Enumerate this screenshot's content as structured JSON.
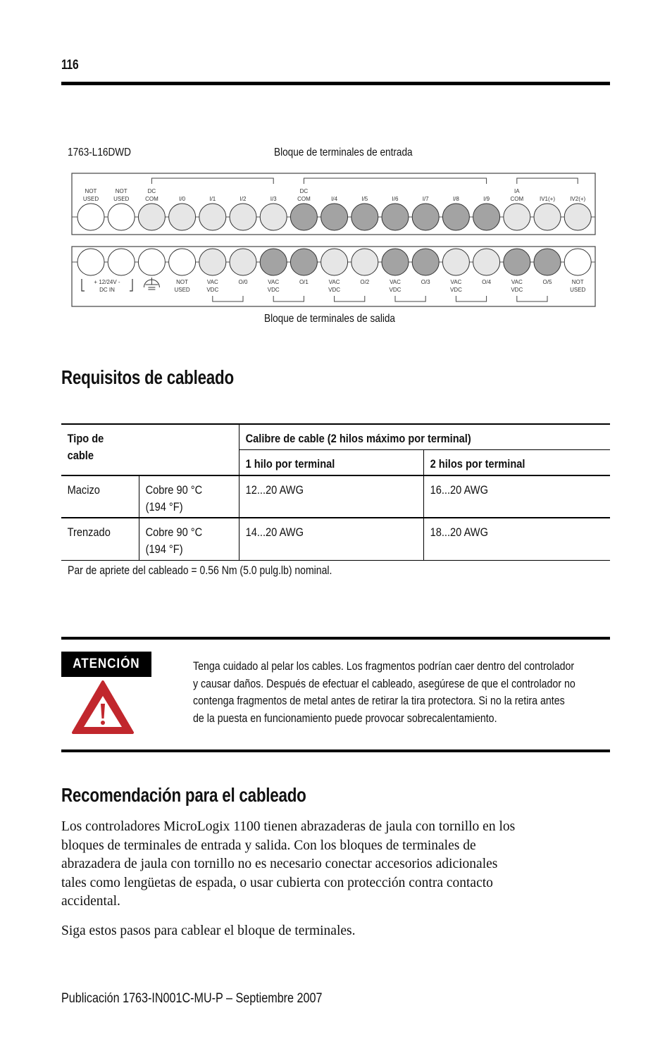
{
  "header": {
    "page_number": "116"
  },
  "diagram": {
    "model": "1763-L16DWD",
    "input_block_title": "Bloque de terminales de entrada",
    "output_block_title": "Bloque de terminales de salida",
    "input_terminals": [
      {
        "label": [
          "NOT",
          "USED"
        ],
        "shade": "white"
      },
      {
        "label": [
          "NOT",
          "USED"
        ],
        "shade": "white"
      },
      {
        "label": [
          "DC",
          "COM"
        ],
        "shade": "light"
      },
      {
        "label": [
          "I/0"
        ],
        "shade": "light"
      },
      {
        "label": [
          "I/1"
        ],
        "shade": "light"
      },
      {
        "label": [
          "I/2"
        ],
        "shade": "light"
      },
      {
        "label": [
          "I/3"
        ],
        "shade": "light"
      },
      {
        "label": [
          "DC",
          "COM"
        ],
        "shade": "dark"
      },
      {
        "label": [
          "I/4"
        ],
        "shade": "dark"
      },
      {
        "label": [
          "I/5"
        ],
        "shade": "dark"
      },
      {
        "label": [
          "I/6"
        ],
        "shade": "dark"
      },
      {
        "label": [
          "I/7"
        ],
        "shade": "dark"
      },
      {
        "label": [
          "I/8"
        ],
        "shade": "dark"
      },
      {
        "label": [
          "I/9"
        ],
        "shade": "dark"
      },
      {
        "label": [
          "IA",
          "COM"
        ],
        "shade": "light"
      },
      {
        "label": [
          "IV1(+)"
        ],
        "shade": "light"
      },
      {
        "label": [
          "IV2(+)"
        ],
        "shade": "light"
      }
    ],
    "output_terminals": [
      {
        "label": [],
        "shade": "white"
      },
      {
        "label": [],
        "shade": "white"
      },
      {
        "label": [],
        "shade": "white"
      },
      {
        "label": [
          "NOT",
          "USED"
        ],
        "shade": "white"
      },
      {
        "label": [
          "VAC",
          "VDC"
        ],
        "shade": "light"
      },
      {
        "label": [
          "O/0"
        ],
        "shade": "light"
      },
      {
        "label": [
          "VAC",
          "VDC"
        ],
        "shade": "dark"
      },
      {
        "label": [
          "O/1"
        ],
        "shade": "dark"
      },
      {
        "label": [
          "VAC",
          "VDC"
        ],
        "shade": "light"
      },
      {
        "label": [
          "O/2"
        ],
        "shade": "light"
      },
      {
        "label": [
          "VAC",
          "VDC"
        ],
        "shade": "dark"
      },
      {
        "label": [
          "O/3"
        ],
        "shade": "dark"
      },
      {
        "label": [
          "VAC",
          "VDC"
        ],
        "shade": "light"
      },
      {
        "label": [
          "O/4"
        ],
        "shade": "light"
      },
      {
        "label": [
          "VAC",
          "VDC"
        ],
        "shade": "dark"
      },
      {
        "label": [
          "O/5"
        ],
        "shade": "dark"
      },
      {
        "label": [
          "NOT",
          "USED"
        ],
        "shade": "white"
      }
    ],
    "power_label": [
      "+ 12/24V -",
      "DC IN"
    ],
    "colors": {
      "white": "#ffffff",
      "light": "#e6e6e6",
      "dark": "#a3a3a3"
    }
  },
  "section1": {
    "title": "Requisitos de cableado",
    "table": {
      "col1_header": "Tipo de cable",
      "col1_header_lines": [
        "Tipo de",
        "cable"
      ],
      "group_header": "Calibre de cable (2 hilos máximo por terminal)",
      "sub_headers": [
        "1 hilo por terminal",
        "2 hilos por terminal"
      ],
      "rows": [
        {
          "type": "Macizo",
          "material": [
            "Cobre 90 °C",
            "(194 °F)"
          ],
          "one_wire": "12...20 AWG",
          "two_wires": "16...20 AWG"
        },
        {
          "type": "Trenzado",
          "material": [
            "Cobre 90 °C",
            "(194 °F)"
          ],
          "one_wire": "14...20 AWG",
          "two_wires": "18...20 AWG"
        }
      ],
      "footnote": "Par de apriete del cableado = 0.56 Nm (5.0 pulg.lb) nominal."
    }
  },
  "attention": {
    "badge": "ATENCIÓN",
    "icon": "warning-triangle-icon",
    "icon_color": "#c1272d",
    "lines": [
      "Tenga cuidado al pelar los cables. Los fragmentos podrían caer dentro del controlador",
      "y causar daños. Después de efectuar el cableado, asegúrese de que el controlador no",
      "contenga fragmentos de metal antes de retirar la tira protectora. Si no la retira antes",
      "de la puesta en funcionamiento puede provocar sobrecalentamiento."
    ]
  },
  "section2": {
    "title": "Recomendación para el cableado",
    "paragraph1_lines": [
      "Los controladores MicroLogix 1100 tienen abrazaderas de jaula con tornillo en los",
      "bloques de terminales de entrada y salida. Con los bloques de terminales de",
      "abrazadera de jaula con tornillo no es necesario conectar accesorios adicionales",
      "tales como lengüetas de espada, o usar cubierta con protección contra contacto",
      "accidental."
    ],
    "paragraph2": "Siga estos pasos para cablear el bloque de terminales."
  },
  "footer": {
    "publication": "Publicación 1763-IN001C-MU-P – Septiembre 2007"
  }
}
